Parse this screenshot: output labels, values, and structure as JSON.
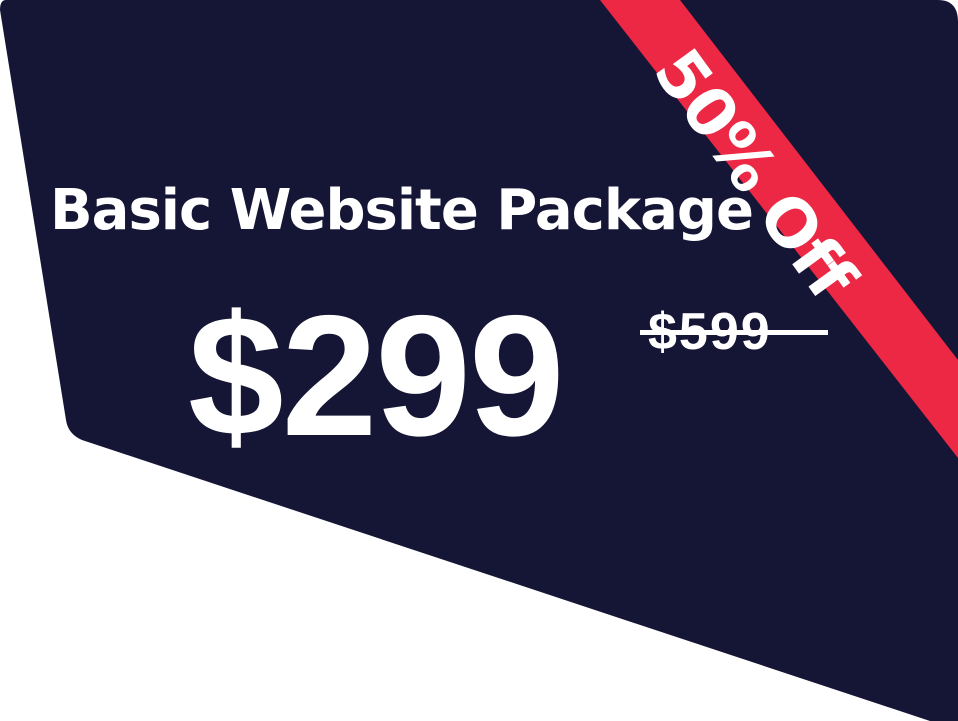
{
  "colors": {
    "card_background": "#151535",
    "ribbon": "#EC2845",
    "text": "#ffffff",
    "page_background": "#ffffff"
  },
  "package": {
    "title": "Basic Website Package",
    "price": "$299",
    "original_price": "$599"
  },
  "ribbon": {
    "label": "50% Off"
  }
}
